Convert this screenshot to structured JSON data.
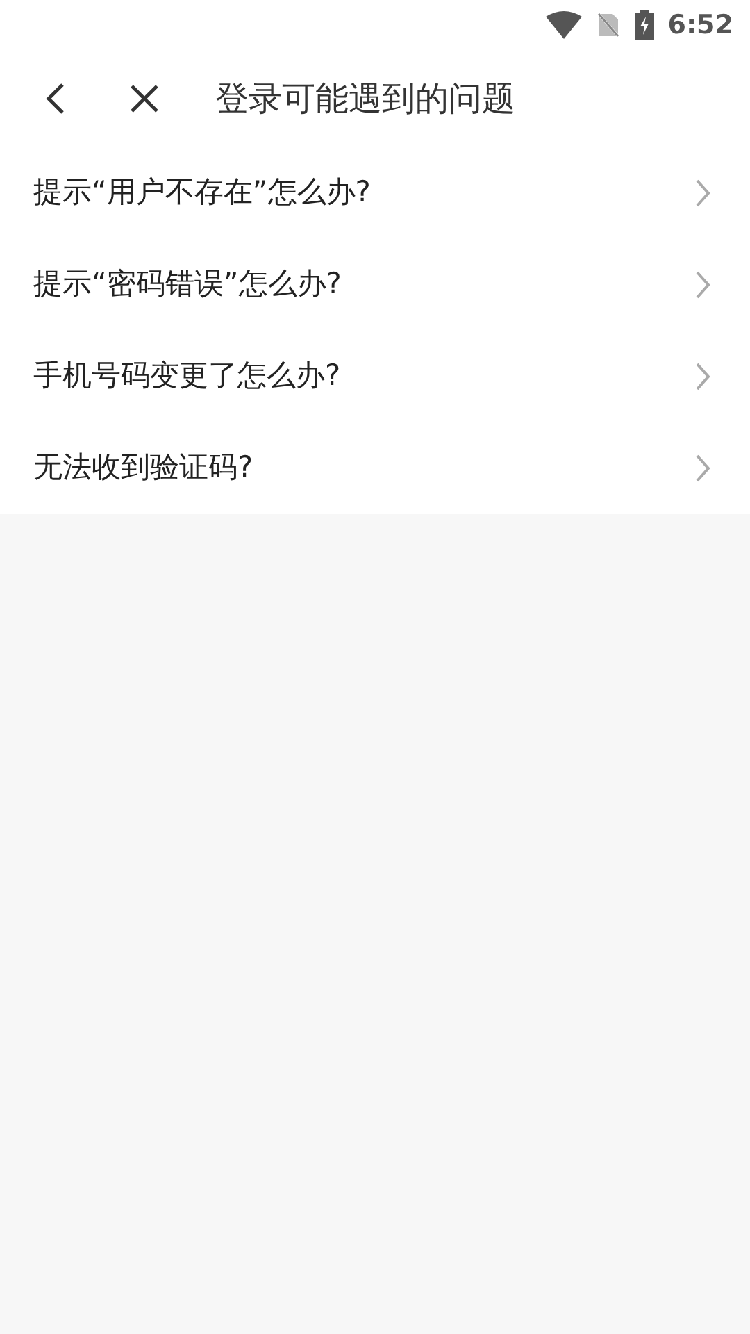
{
  "status_bar": {
    "time": "6:52"
  },
  "header": {
    "title": "登录可能遇到的问题"
  },
  "items": [
    {
      "label": "提示“用户不存在”怎么办?"
    },
    {
      "label": "提示“密码错误”怎么办?"
    },
    {
      "label": "手机号码变更了怎么办?"
    },
    {
      "label": "无法收到验证码?"
    }
  ]
}
